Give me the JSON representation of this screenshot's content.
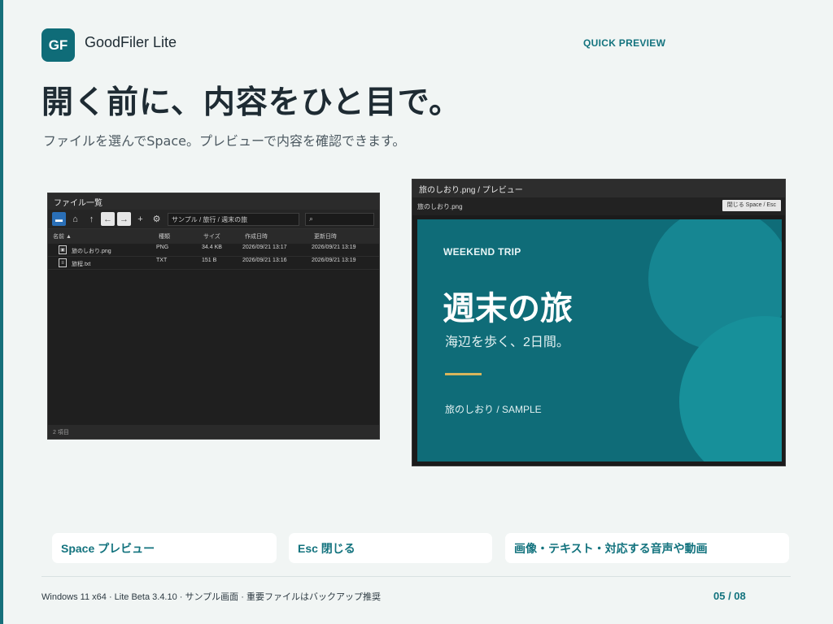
{
  "brand": {
    "logo_text": "GF",
    "app_name": "GoodFiler Lite"
  },
  "section_tag": "QUICK PREVIEW",
  "headline": "開く前に、内容をひと目で。",
  "subline": "ファイルを選んでSpace。プレビューで内容を確認できます。",
  "file_window": {
    "title": "ファイル一覧",
    "toolbar": {
      "icons": [
        "folder-icon",
        "home-icon",
        "up-icon",
        "back-icon",
        "forward-icon",
        "plus-icon",
        "settings-icon"
      ],
      "path": "サンプル / 旅行 / 週末の旅",
      "search_placeholder": ""
    },
    "columns": [
      "名前 ▲",
      "種類",
      "サイズ",
      "作成日時",
      "更新日時"
    ],
    "rows": [
      {
        "name": "旅のしおり.png",
        "type": "PNG",
        "size": "34.4 KB",
        "created": "2026/09/21 13:17",
        "modified": "2026/09/21 13:19",
        "icon": "image-file-icon"
      },
      {
        "name": "旅程.txt",
        "type": "TXT",
        "size": "151 B",
        "created": "2026/09/21 13:16",
        "modified": "2026/09/21 13:19",
        "icon": "text-file-icon"
      }
    ],
    "status": "2 項目"
  },
  "preview_window": {
    "title": "旅のしおり.png / プレビュー",
    "filename": "旅のしおり.png",
    "close_label": "閉じる Space / Esc",
    "slide": {
      "kicker": "WEEKEND TRIP",
      "title": "週末の旅",
      "subtitle": "海辺を歩く、2日間。",
      "footer": "旅のしおり / SAMPLE"
    }
  },
  "hints": [
    {
      "label": "Space  プレビュー"
    },
    {
      "label": "Esc  閉じる"
    },
    {
      "label": "画像・テキスト・対応する音声や動画"
    }
  ],
  "footer": {
    "info": "Windows 11 x64 · Lite Beta 3.4.10 · サンプル画面 · 重要ファイルはバックアップ推奨",
    "page": "05 / 08"
  },
  "colors": {
    "accent": "#13737e",
    "slide_bg": "#0f6c78",
    "gold": "#d8b55c"
  }
}
